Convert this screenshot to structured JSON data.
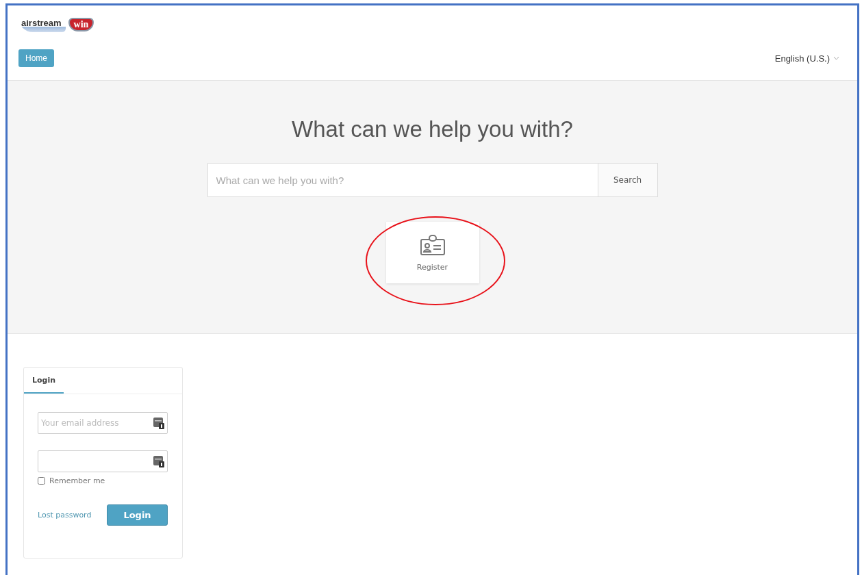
{
  "logo": {
    "wordmark": "airstream",
    "badge": "win"
  },
  "nav": {
    "home": "Home",
    "language": "English (U.S.)"
  },
  "hero": {
    "title": "What can we help you with?",
    "search": {
      "placeholder": "What can we help you with?",
      "button": "Search"
    },
    "tiles": [
      {
        "label": "Register",
        "highlighted": true
      }
    ]
  },
  "login": {
    "tabs": [
      {
        "label": "Login",
        "selected": true
      }
    ],
    "email": {
      "placeholder": "Your email address"
    },
    "remember": {
      "label": "Remember me",
      "checked": false
    },
    "lost_password": "Lost password",
    "button": "Login"
  }
}
